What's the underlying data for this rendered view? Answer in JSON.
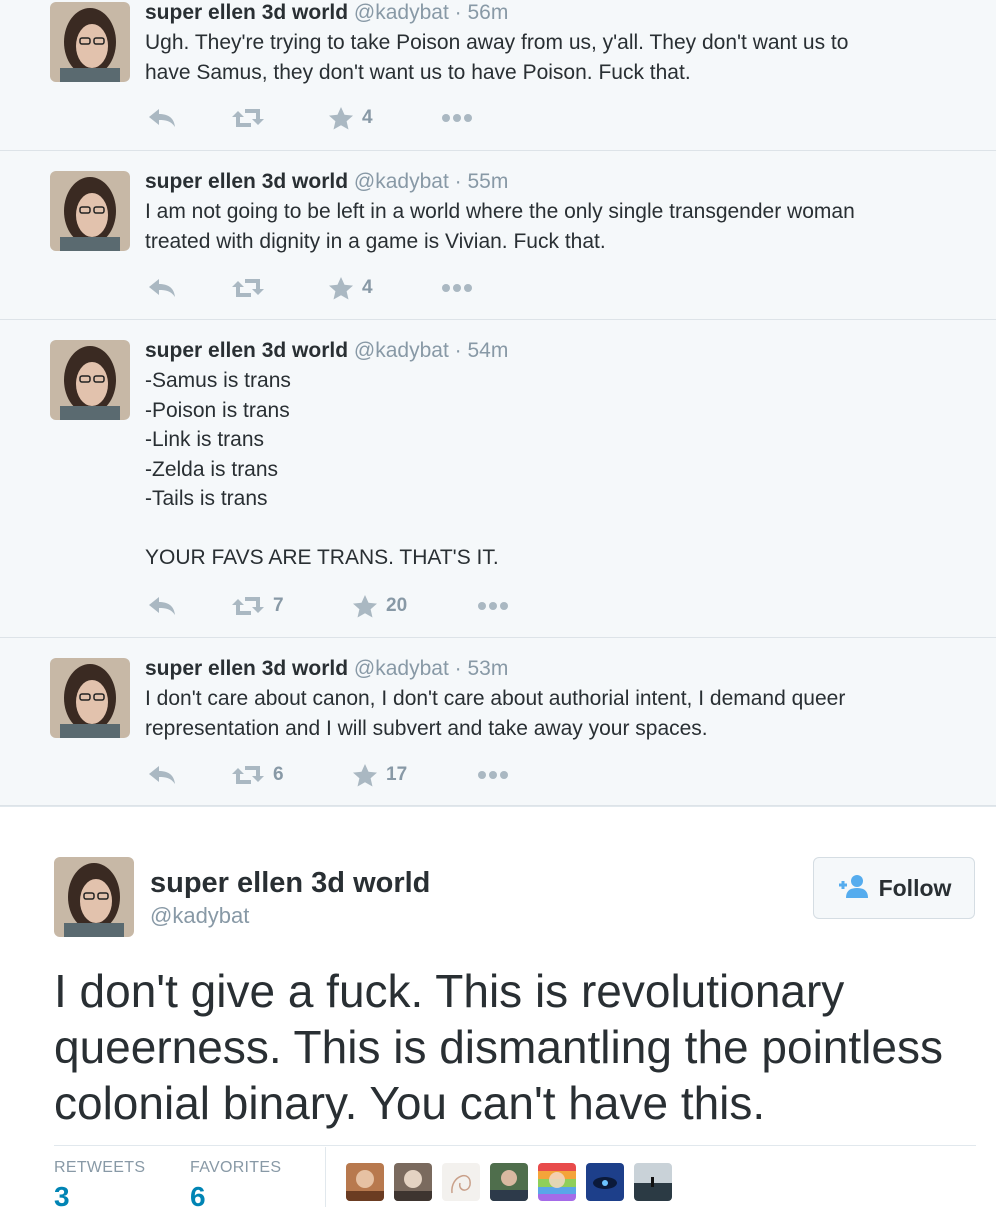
{
  "tweets": [
    {
      "name": "super ellen 3d world",
      "handle": "@kadybat",
      "dot": "·",
      "time": "56m",
      "lines": [
        "Ugh. They're trying to take Poison away from us, y'all. They don't want us to",
        "have Samus, they don't want us to have Poison. Fuck that."
      ],
      "retweets": "",
      "favorites": "4"
    },
    {
      "name": "super ellen 3d world",
      "handle": "@kadybat",
      "dot": "·",
      "time": "55m",
      "lines": [
        "I am not going to be left in a world where the only single transgender woman",
        "treated with dignity in a game is Vivian. Fuck that."
      ],
      "retweets": "",
      "favorites": "4"
    },
    {
      "name": "super ellen 3d world",
      "handle": "@kadybat",
      "dot": "·",
      "time": "54m",
      "lines": [
        "-Samus is trans",
        "-Poison is trans",
        "-Link is trans",
        "-Zelda is trans",
        "-Tails is trans",
        "",
        "YOUR FAVS ARE TRANS. THAT'S IT."
      ],
      "retweets": "7",
      "favorites": "20"
    },
    {
      "name": "super ellen 3d world",
      "handle": "@kadybat",
      "dot": "·",
      "time": "53m",
      "lines": [
        "I don't care about canon, I don't care about authorial intent, I demand queer",
        "representation and I will subvert and take away your spaces."
      ],
      "retweets": "6",
      "favorites": "17"
    }
  ],
  "detail": {
    "name": "super ellen 3d world",
    "handle": "@kadybat",
    "follow_label": "Follow",
    "lines": [
      "I don't give a fuck. This is revolutionary",
      "queerness. This is dismantling the pointless",
      "colonial binary. You can't have this."
    ],
    "retweets_label": "RETWEETS",
    "retweets_value": "3",
    "favorites_label": "FAVORITES",
    "favorites_value": "6"
  },
  "icons": {
    "reply": "reply-icon",
    "retweet": "retweet-icon",
    "favorite": "star-icon",
    "more": "more-icon",
    "follow": "add-person-icon"
  },
  "colors": {
    "timeline_bg": "#f5f8fa",
    "name": "#292f33",
    "muted": "#8899a6",
    "action_icon": "#aab8c2",
    "accent_blue": "#55acee",
    "stat_value": "#0084b4"
  }
}
